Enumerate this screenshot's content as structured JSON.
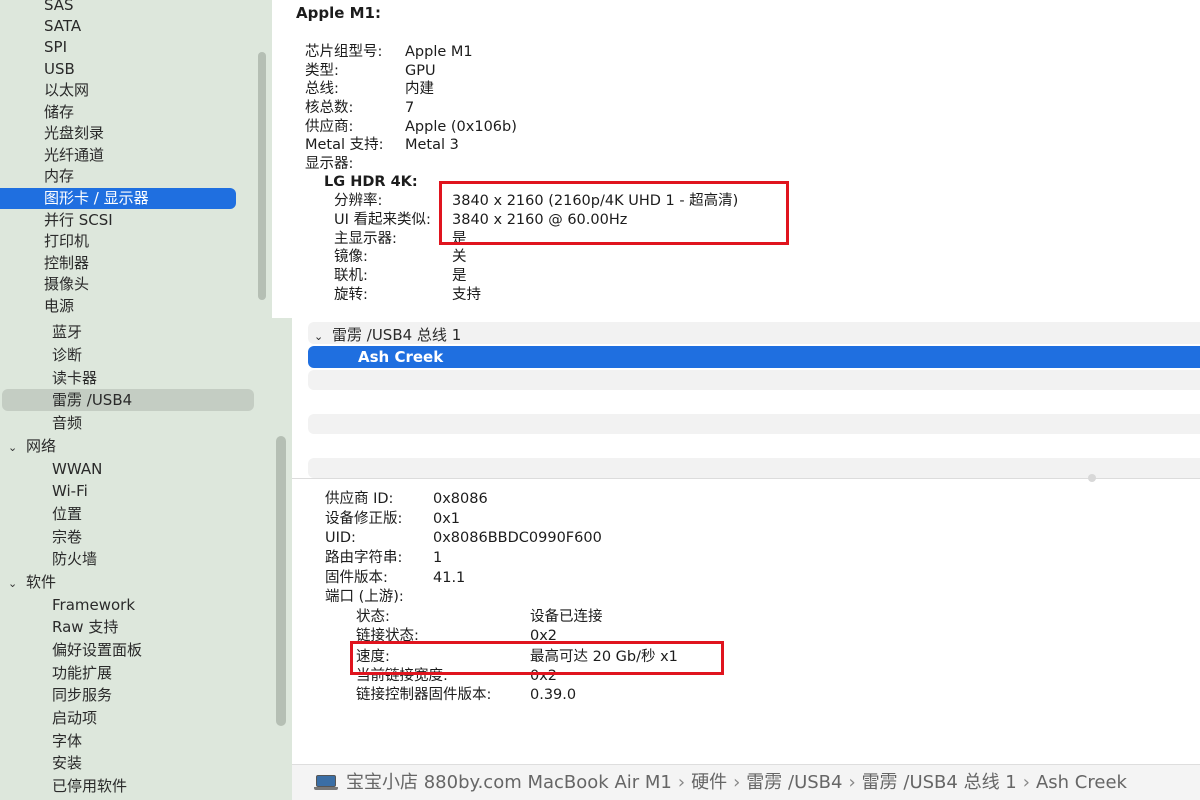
{
  "sidebar_top": {
    "items": [
      "SAS",
      "SATA",
      "SPI",
      "USB",
      "以太网",
      "储存",
      "光盘刻录",
      "光纤通道",
      "内存",
      "图形卡 / 显示器",
      "并行 SCSI",
      "打印机",
      "控制器",
      "摄像头",
      "电源"
    ],
    "selected": "图形卡 / 显示器"
  },
  "sidebar_bottom": {
    "items_a": [
      "蓝牙",
      "诊断",
      "读卡器",
      "雷雳 /USB4",
      "音频"
    ],
    "network_label": "网络",
    "network_items": [
      "WWAN",
      "Wi-Fi",
      "位置",
      "宗卷",
      "防火墙"
    ],
    "software_label": "软件",
    "software_items": [
      "Framework",
      "Raw 支持",
      "偏好设置面板",
      "功能扩展",
      "同步服务",
      "启动项",
      "字体",
      "安装",
      "已停用软件"
    ]
  },
  "graphics": {
    "title": "Apple M1:",
    "rows": [
      {
        "k": "芯片组型号:",
        "v": "Apple M1"
      },
      {
        "k": "类型:",
        "v": "GPU"
      },
      {
        "k": "总线:",
        "v": "内建"
      },
      {
        "k": "核总数:",
        "v": "7"
      },
      {
        "k": "供应商:",
        "v": "Apple (0x106b)"
      },
      {
        "k": "Metal 支持:",
        "v": "Metal 3"
      },
      {
        "k": "显示器:",
        "v": ""
      }
    ],
    "display_title": "LG HDR 4K:",
    "display_rows": [
      {
        "k": "分辨率:",
        "v": "3840 x 2160 (2160p/4K UHD 1 - 超高清)"
      },
      {
        "k": "UI 看起来类似:",
        "v": "3840 x 2160 @ 60.00Hz"
      },
      {
        "k": "主显示器:",
        "v": "是"
      },
      {
        "k": "镜像:",
        "v": "关"
      },
      {
        "k": "联机:",
        "v": "是"
      },
      {
        "k": "旋转:",
        "v": "支持"
      }
    ]
  },
  "tree": {
    "parent": "雷雳 /USB4 总线 1",
    "selected": "Ash Creek"
  },
  "device": {
    "rows": [
      {
        "k": "供应商 ID:",
        "v": "0x8086"
      },
      {
        "k": "设备修正版:",
        "v": "0x1"
      },
      {
        "k": "UID:",
        "v": "0x8086BBDC0990F600"
      },
      {
        "k": "路由字符串:",
        "v": "1"
      },
      {
        "k": "固件版本:",
        "v": "41.1"
      },
      {
        "k": "端口 (上游):",
        "v": ""
      }
    ],
    "port_rows": [
      {
        "k": "状态:",
        "v": "设备已连接"
      },
      {
        "k": "链接状态:",
        "v": "0x2"
      },
      {
        "k": "速度:",
        "v": "最高可达 20 Gb/秒 x1"
      },
      {
        "k": "当前链接宽度:",
        "v": "0x2"
      },
      {
        "k": "链接控制器固件版本:",
        "v": "0.39.0"
      }
    ]
  },
  "pathbar": {
    "segments": [
      "宝宝小店 880by.com MacBook Air M1",
      "硬件",
      "雷雳 /USB4",
      "雷雳 /USB4 总线 1",
      "Ash Creek"
    ],
    "separator": "›"
  },
  "colors": {
    "sidebar_bg": "#dde7dc",
    "selection_blue": "#1f6fe0",
    "highlight_red": "#e0141e"
  }
}
